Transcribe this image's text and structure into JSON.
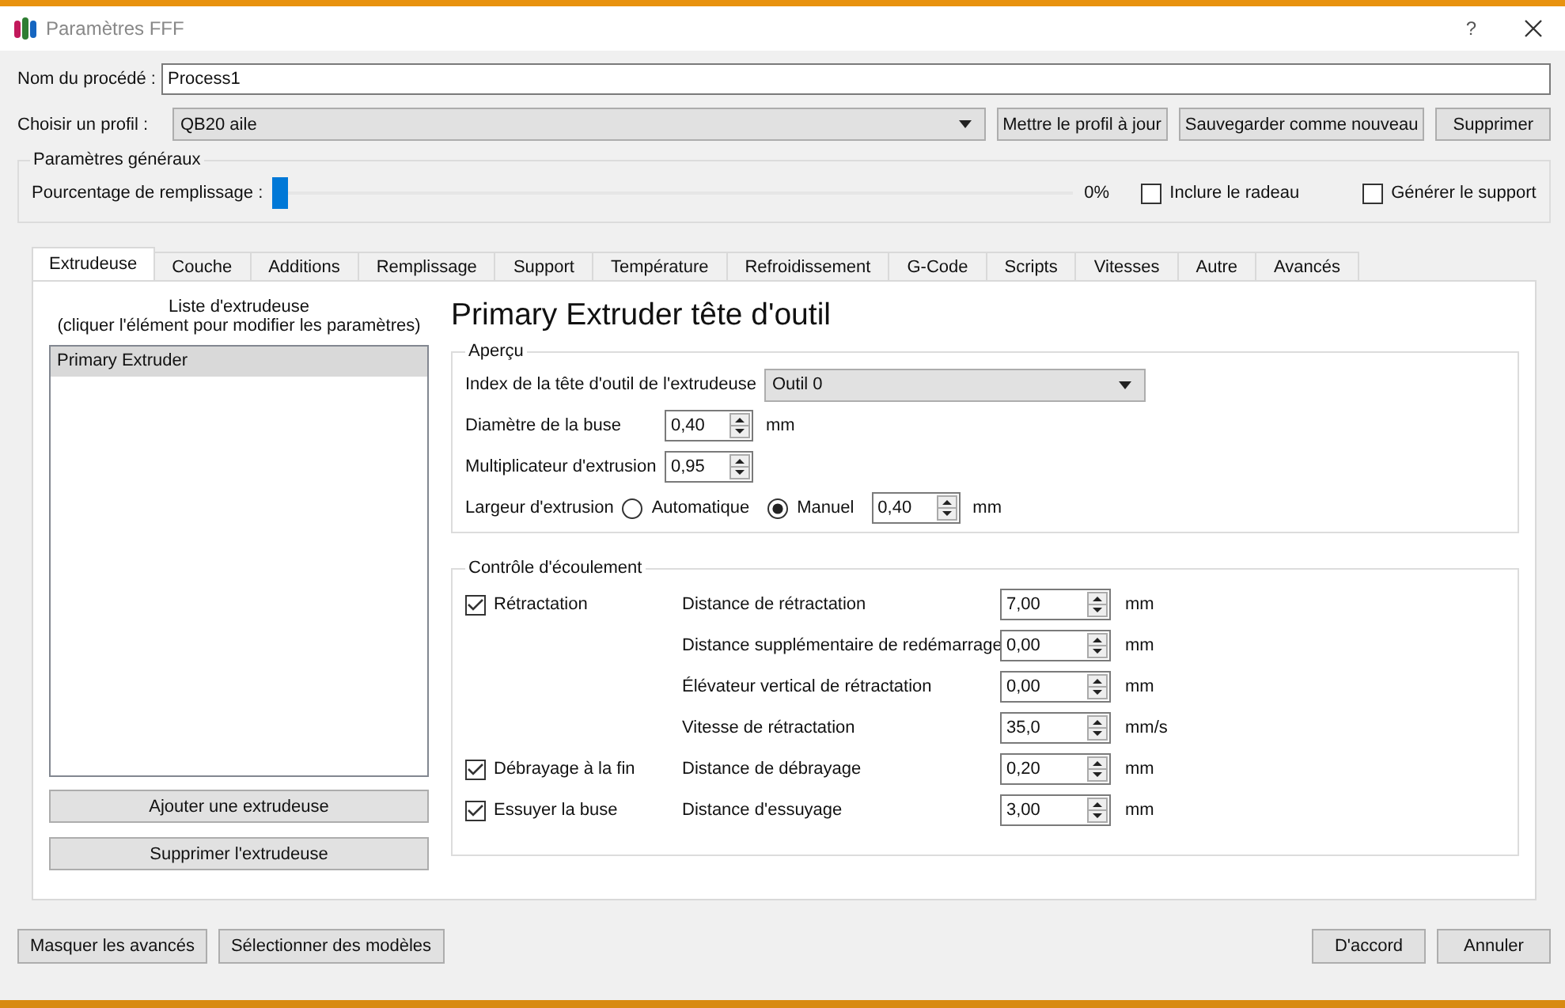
{
  "window": {
    "title": "Paramètres FFF",
    "help": "?"
  },
  "process_name": {
    "label": "Nom du procédé :",
    "value": "Process1"
  },
  "profile": {
    "label": "Choisir un profil :",
    "value": "QB20 aile",
    "buttons": [
      "Mettre le profil à jour",
      "Sauvegarder comme nouveau",
      "Supprimer"
    ]
  },
  "general": {
    "title": "Paramètres généraux",
    "infill_label": "Pourcentage de remplissage :",
    "level": 0,
    "reading": "0%",
    "checkboxes": [
      {
        "label": "Inclure le radeau",
        "checked": false
      },
      {
        "label": "Générer le support",
        "checked": false
      }
    ]
  },
  "tabs": [
    {
      "label": "Extrudeuse",
      "selected": true
    },
    {
      "label": "Couche",
      "selected": false
    },
    {
      "label": "Additions",
      "selected": false
    },
    {
      "label": "Remplissage",
      "selected": false
    },
    {
      "label": "Support",
      "selected": false
    },
    {
      "label": "Température",
      "selected": false
    },
    {
      "label": "Refroidissement",
      "selected": false
    },
    {
      "label": "G-Code",
      "selected": false
    },
    {
      "label": "Scripts",
      "selected": false
    },
    {
      "label": "Vitesses",
      "selected": false
    },
    {
      "label": "Autre",
      "selected": false
    },
    {
      "label": "Avancés",
      "selected": false
    }
  ],
  "extruder_list": {
    "heading": "Liste d'extrudeuse",
    "hint": "(cliquer l'élément pour modifier les paramètres)",
    "items": [
      {
        "label": "Primary Extruder",
        "selected": true
      }
    ],
    "buttons": [
      "Ajouter une extrudeuse",
      "Supprimer l'extrudeuse"
    ]
  },
  "panel_title": "Primary Extruder tête d'outil",
  "overview": {
    "title": "Aperçu",
    "tool_index": {
      "label": "Index de la tête d'outil de l'extrudeuse",
      "value": "Outil 0"
    },
    "nozzle": {
      "label": "Diamètre de la buse",
      "value": "0,40",
      "unit": "mm"
    },
    "multiplier": {
      "label": "Multiplicateur d'extrusion",
      "value": "0,95"
    },
    "width": {
      "label": "Largeur d'extrusion",
      "options": [
        {
          "label": "Automatique",
          "selected": false
        },
        {
          "label": "Manuel",
          "selected": true
        }
      ],
      "value": "0,40",
      "unit": "mm"
    }
  },
  "flow": {
    "title": "Contrôle d'écoulement",
    "rows": [
      {
        "check": {
          "label": "Rétractation",
          "checked": true
        },
        "label": "Distance de rétractation",
        "value": "7,00",
        "unit": "mm"
      },
      {
        "label": "Distance supplémentaire de redémarrage",
        "value": "0,00",
        "unit": "mm"
      },
      {
        "label": "Élévateur vertical de rétractation",
        "value": "0,00",
        "unit": "mm"
      },
      {
        "label": "Vitesse de rétractation",
        "value": "35,0",
        "unit": "mm/s"
      },
      {
        "check": {
          "label": "Débrayage à la fin",
          "checked": true
        },
        "label": "Distance de débrayage",
        "value": "0,20",
        "unit": "mm"
      },
      {
        "check": {
          "label": "Essuyer la buse",
          "checked": true
        },
        "label": "Distance d'essuyage",
        "value": "3,00",
        "unit": "mm"
      }
    ]
  },
  "footer": {
    "left_buttons": [
      "Masquer les avancés",
      "Sélectionner des modèles"
    ],
    "right_buttons": [
      "D'accord",
      "Annuler"
    ]
  }
}
